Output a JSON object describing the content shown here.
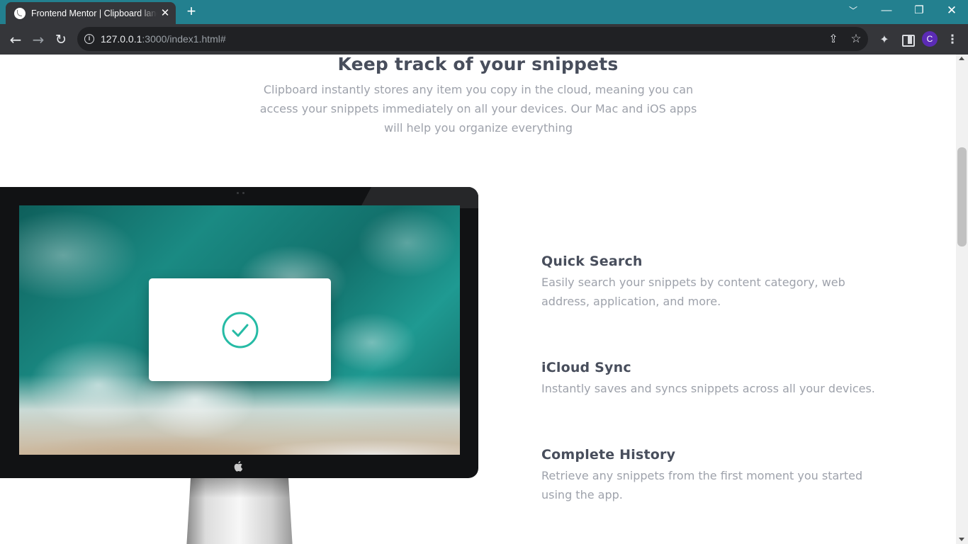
{
  "browser": {
    "tab_title": "Frontend Mentor | Clipboard landing page",
    "tab_close": "✕",
    "new_tab": "+",
    "url_host": "127.0.0.1",
    "url_path": ":3000/index1.html#",
    "avatar_letter": "C",
    "theme_color": "#23808f"
  },
  "page": {
    "heading": "Keep track of your snippets",
    "intro": "Clipboard instantly stores any item you copy in the cloud, meaning you can access your snippets immediately on all your devices. Our Mac and iOS apps will help you organize everything",
    "features": [
      {
        "title": "Quick Search",
        "desc": "Easily search your snippets by content category, web address, application, and more."
      },
      {
        "title": "iCloud Sync",
        "desc": "Instantly saves and syncs snippets across all your devices."
      },
      {
        "title": "Complete History",
        "desc": "Retrieve any snippets from the first moment you started using the app."
      }
    ],
    "accent_color": "#26bba5",
    "heading_color": "#484e5c",
    "text_color": "#9ea2ab"
  }
}
